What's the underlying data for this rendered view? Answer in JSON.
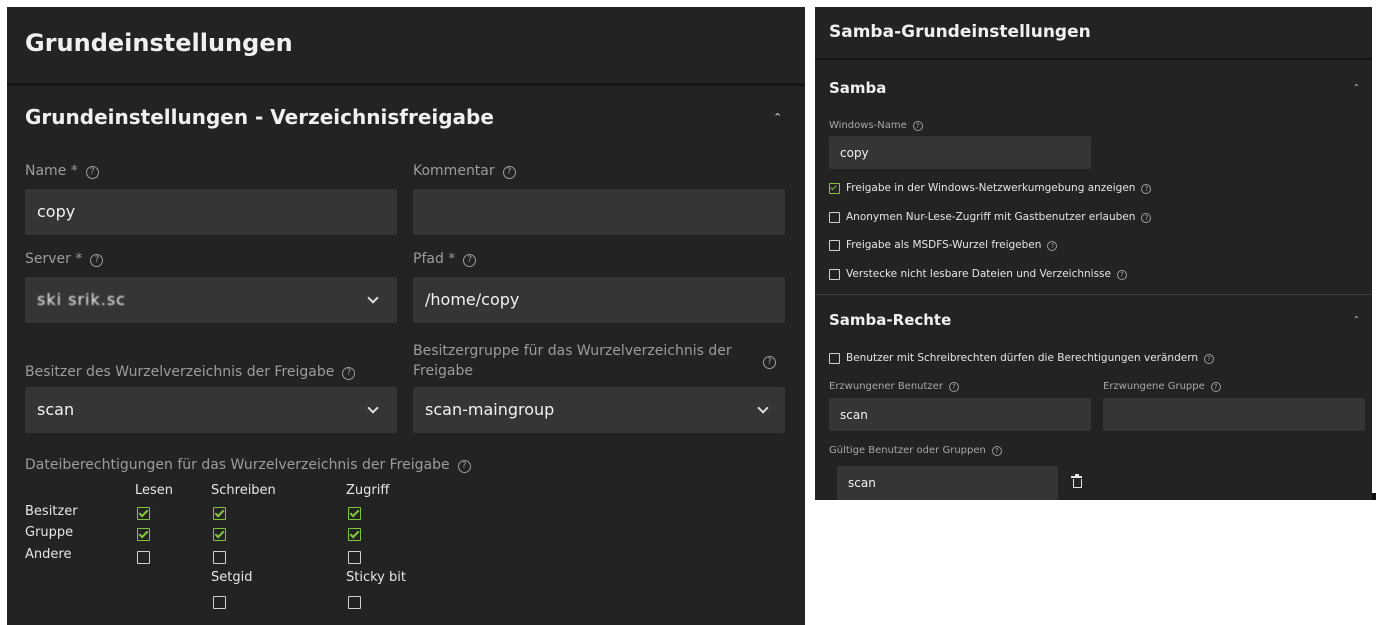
{
  "left": {
    "page_title": "Grundeinstellungen",
    "section_title": "Grundeinstellungen - Verzeichnisfreigabe",
    "name": {
      "label": "Name *",
      "value": "copy"
    },
    "kommentar": {
      "label": "Kommentar",
      "value": ""
    },
    "server": {
      "label": "Server *",
      "value": "ski srik.sc"
    },
    "pfad": {
      "label": "Pfad *",
      "value": "/home/copy"
    },
    "owner": {
      "label": "Besitzer des Wurzelverzeichnis der Freigabe",
      "value": "scan"
    },
    "group": {
      "label_line1": "Besitzergruppe für das Wurzelverzeichnis der",
      "label_line2": "Freigabe",
      "value": "scan-maingroup"
    },
    "permissions": {
      "label": "Dateiberechtigungen für das Wurzelverzeichnis der Freigabe",
      "columns": [
        "Lesen",
        "Schreiben",
        "Zugriff"
      ],
      "rows": [
        {
          "name": "Besitzer",
          "values": [
            true,
            true,
            true
          ]
        },
        {
          "name": "Gruppe",
          "values": [
            true,
            true,
            true
          ]
        },
        {
          "name": "Andere",
          "values": [
            false,
            false,
            false
          ]
        }
      ],
      "setgid": {
        "label": "Setgid",
        "checked": false
      },
      "sticky": {
        "label": "Sticky bit",
        "checked": false
      }
    }
  },
  "right": {
    "page_title": "Samba-Grundeinstellungen",
    "samba_section": "Samba",
    "windows_name": {
      "label": "Windows-Name",
      "value": "copy"
    },
    "checkboxes": [
      {
        "label": "Freigabe in der Windows-Netzwerkumgebung anzeigen",
        "checked": true
      },
      {
        "label": "Anonymen Nur-Lese-Zugriff mit Gastbenutzer erlauben",
        "checked": false
      },
      {
        "label": "Freigabe als MSDFS-Wurzel freigeben",
        "checked": false
      },
      {
        "label": "Verstecke nicht lesbare Dateien und Verzeichnisse",
        "checked": false
      }
    ],
    "rights_section": "Samba-Rechte",
    "write_users_modify": {
      "label": "Benutzer mit Schreibrechten dürfen die Berechtigungen verändern",
      "checked": false
    },
    "forced_user": {
      "label": "Erzwungener Benutzer",
      "value": "scan"
    },
    "forced_group": {
      "label": "Erzwungene Gruppe",
      "value": ""
    },
    "valid_users": {
      "label": "Gültige Benutzer oder Gruppen",
      "value": "scan"
    }
  },
  "colors": {
    "panel": "#232323",
    "input": "#353535",
    "check": "#82c63c"
  }
}
